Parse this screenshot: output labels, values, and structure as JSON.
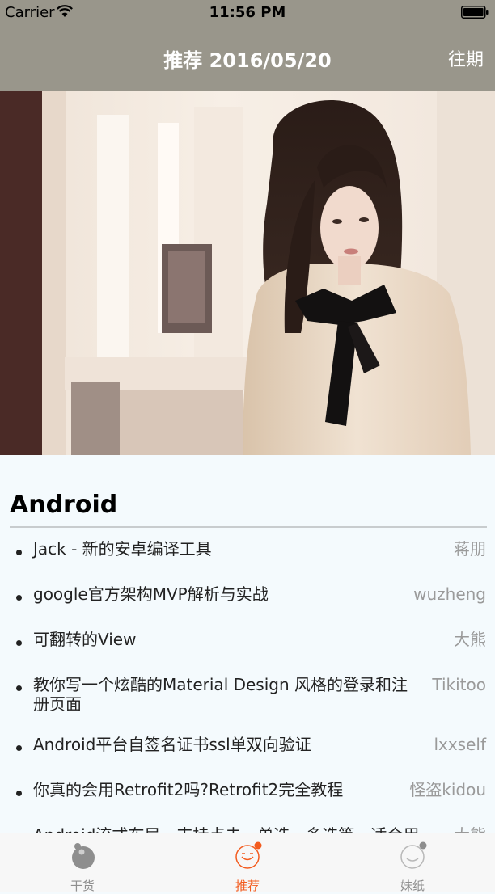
{
  "status_bar": {
    "carrier": "Carrier",
    "time": "11:56 PM"
  },
  "nav": {
    "title": "推荐 2016/05/20",
    "archive_label": "往期"
  },
  "section": {
    "title": "Android",
    "articles": [
      {
        "title": "Jack - 新的安卓编译工具",
        "author": "蒋朋"
      },
      {
        "title": "google官方架构MVP解析与实战",
        "author": "wuzheng"
      },
      {
        "title": "可翻转的View",
        "author": "大熊"
      },
      {
        "title": "教你写一个炫酷的Material Design 风格的登录和注册页面",
        "author": "Tikitoo"
      },
      {
        "title": "Android平台自签名证书ssl单双向验证",
        "author": "lxxself"
      },
      {
        "title": "你真的会用Retrofit2吗?Retrofit2完全教程",
        "author": "怪盗kidou"
      },
      {
        "title": "Android流式布局，支持点击、单选、多选等，适合用",
        "author": "大熊"
      }
    ]
  },
  "tabbar": {
    "tabs": [
      {
        "label": "干货",
        "icon": "dry-goods-icon",
        "active": false
      },
      {
        "label": "推荐",
        "icon": "recommend-icon",
        "active": true
      },
      {
        "label": "妹纸",
        "icon": "girl-icon",
        "active": false
      }
    ]
  },
  "colors": {
    "nav_background": "#99968b",
    "accent": "#f35b1e",
    "content_background": "#f4fafd",
    "author_text": "#9a9a9a"
  }
}
